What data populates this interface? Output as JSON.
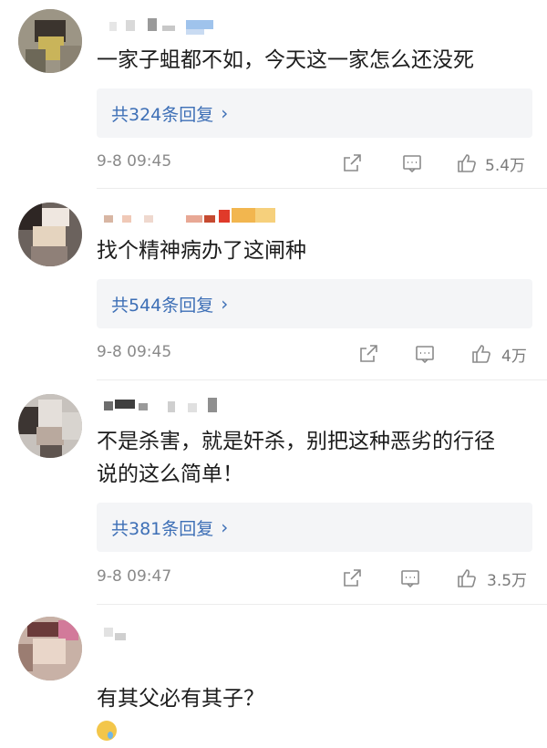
{
  "comments": [
    {
      "text": "一家子蛆都不如，今天这一家怎么还没死",
      "reply_label": "共324条回复",
      "chevron": "›",
      "time": "9-8 09:45",
      "likes": "5.4万"
    },
    {
      "text": "找个精神病办了这闸种",
      "reply_label": "共544条回复",
      "chevron": "›",
      "time": "9-8 09:45",
      "likes": "4万"
    },
    {
      "text": "不是杀害，就是奸杀，别把这种恶劣的行径\n说的这么简单！",
      "reply_label": "共381条回复",
      "chevron": "›",
      "time": "9-8 09:47",
      "likes": "3.5万"
    },
    {
      "text": "有其父必有其子？"
    }
  ],
  "icons": {
    "share": "share-icon",
    "comment": "comment-icon",
    "like": "thumbs-up-icon",
    "emoji": "sad-sweat-emoji-icon"
  },
  "colors": {
    "reply_link": "#3d6fb6",
    "reply_bg": "#f4f5f7",
    "meta_text": "#8a8a8a"
  }
}
